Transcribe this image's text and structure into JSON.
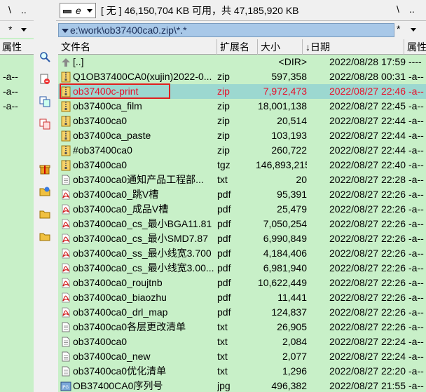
{
  "left_panel": {
    "top_label": "\\",
    "top_dots": "..",
    "sort_label": "*",
    "header_attr": "属性",
    "rows": [
      "-a--",
      "-a--",
      "-a--"
    ]
  },
  "drive_bar": {
    "drive_letter": "e",
    "info": "[ 无 ]  46,150,704 KB 可用，共 47,185,920 KB",
    "right_labels": [
      "\\",
      ".."
    ],
    "sort_label": "*"
  },
  "path": "e:\\work\\ob37400ca0.zip\\*.*",
  "columns": {
    "name": "文件名",
    "ext": "扩展名",
    "size": "大小",
    "date": "↓日期",
    "attr": "属性"
  },
  "files": [
    {
      "name": "[..]",
      "ext": "",
      "size": "<DIR>",
      "date": "2022/08/28 17:59",
      "attr": "----",
      "icon": "up-folder-icon"
    },
    {
      "name": "Q1OB37400CA0(xujin)2022-0...",
      "ext": "zip",
      "size": "597,358",
      "date": "2022/08/28 00:31",
      "attr": "-a--",
      "icon": "zip-icon"
    },
    {
      "name": "ob37400c-print",
      "ext": "zip",
      "size": "7,972,473",
      "date": "2022/08/27 22:46",
      "attr": "-a--",
      "icon": "zip-icon",
      "selected": true
    },
    {
      "name": "ob37400ca_film",
      "ext": "zip",
      "size": "18,001,138",
      "date": "2022/08/27 22:45",
      "attr": "-a--",
      "icon": "zip-icon"
    },
    {
      "name": "ob37400ca0",
      "ext": "zip",
      "size": "20,514",
      "date": "2022/08/27 22:44",
      "attr": "-a--",
      "icon": "zip-icon"
    },
    {
      "name": "ob37400ca_paste",
      "ext": "zip",
      "size": "103,193",
      "date": "2022/08/27 22:44",
      "attr": "-a--",
      "icon": "zip-icon"
    },
    {
      "name": "#ob37400ca0",
      "ext": "zip",
      "size": "260,722",
      "date": "2022/08/27 22:44",
      "attr": "-a--",
      "icon": "zip-icon"
    },
    {
      "name": "ob37400ca0",
      "ext": "tgz",
      "size": "146,893,215",
      "date": "2022/08/27 22:40",
      "attr": "-a--",
      "icon": "zip-icon"
    },
    {
      "name": "ob37400ca0通知产品工程部...",
      "ext": "txt",
      "size": "20",
      "date": "2022/08/27 22:28",
      "attr": "-a--",
      "icon": "txt-icon"
    },
    {
      "name": "ob37400ca0_跳V槽",
      "ext": "pdf",
      "size": "95,391",
      "date": "2022/08/27 22:26",
      "attr": "-a--",
      "icon": "pdf-icon"
    },
    {
      "name": "ob37400ca0_成品V槽",
      "ext": "pdf",
      "size": "25,479",
      "date": "2022/08/27 22:26",
      "attr": "-a--",
      "icon": "pdf-icon"
    },
    {
      "name": "ob37400ca0_cs_最小BGA11.81",
      "ext": "pdf",
      "size": "7,050,254",
      "date": "2022/08/27 22:26",
      "attr": "-a--",
      "icon": "pdf-icon"
    },
    {
      "name": "ob37400ca0_cs_最小SMD7.87",
      "ext": "pdf",
      "size": "6,990,849",
      "date": "2022/08/27 22:26",
      "attr": "-a--",
      "icon": "pdf-icon"
    },
    {
      "name": "ob37400ca0_ss_最小线宽3.700",
      "ext": "pdf",
      "size": "4,184,406",
      "date": "2022/08/27 22:26",
      "attr": "-a--",
      "icon": "pdf-icon"
    },
    {
      "name": "ob37400ca0_cs_最小线宽3.00...",
      "ext": "pdf",
      "size": "6,981,940",
      "date": "2022/08/27 22:26",
      "attr": "-a--",
      "icon": "pdf-icon"
    },
    {
      "name": "ob37400ca0_roujtnb",
      "ext": "pdf",
      "size": "10,622,449",
      "date": "2022/08/27 22:26",
      "attr": "-a--",
      "icon": "pdf-icon"
    },
    {
      "name": "ob37400ca0_biaozhu",
      "ext": "pdf",
      "size": "11,441",
      "date": "2022/08/27 22:26",
      "attr": "-a--",
      "icon": "pdf-icon"
    },
    {
      "name": "ob37400ca0_drl_map",
      "ext": "pdf",
      "size": "124,837",
      "date": "2022/08/27 22:26",
      "attr": "-a--",
      "icon": "pdf-icon"
    },
    {
      "name": "ob37400ca0各层更改清单",
      "ext": "txt",
      "size": "26,905",
      "date": "2022/08/27 22:26",
      "attr": "-a--",
      "icon": "txt-icon"
    },
    {
      "name": "ob37400ca0",
      "ext": "txt",
      "size": "2,084",
      "date": "2022/08/27 22:24",
      "attr": "-a--",
      "icon": "txt-icon"
    },
    {
      "name": "ob37400ca0_new",
      "ext": "txt",
      "size": "2,077",
      "date": "2022/08/27 22:24",
      "attr": "-a--",
      "icon": "txt-icon"
    },
    {
      "name": "ob37400ca0优化清单",
      "ext": "txt",
      "size": "1,296",
      "date": "2022/08/27 22:20",
      "attr": "-a--",
      "icon": "txt-icon"
    },
    {
      "name": "OB37400CA0序列号",
      "ext": "jpg",
      "size": "496,382",
      "date": "2022/08/27 21:55",
      "attr": "-a--",
      "icon": "jpg-icon"
    }
  ],
  "colors": {
    "list_bg": "#c8f0c8",
    "selected_bg": "#9cd8d0",
    "selected_text": "#e8112b",
    "path_bg": "#a8c8e8",
    "highlight_box": "#e02020"
  }
}
